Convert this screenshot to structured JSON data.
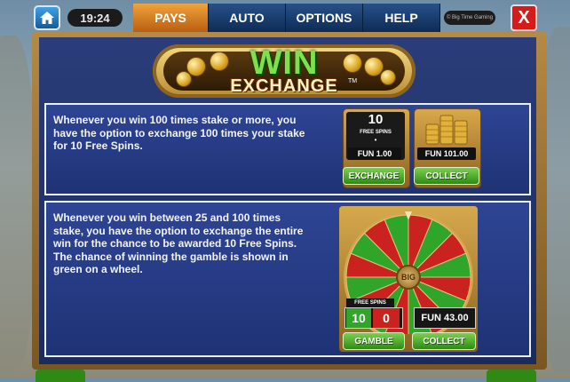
{
  "topbar": {
    "clock": "19:24",
    "tabs": [
      {
        "label": "PAYS",
        "active": true
      },
      {
        "label": "AUTO",
        "active": false
      },
      {
        "label": "OPTIONS",
        "active": false
      },
      {
        "label": "HELP",
        "active": false
      }
    ],
    "brand": "© Big Time Gaming",
    "close_label": "X"
  },
  "title": {
    "line1": "WIN",
    "line2": "EXCHANGE",
    "tm": "TM"
  },
  "panel1": {
    "text": "Whenever you win 100 times stake or more, you have the option to exchange 100 times your stake for 10 Free Spins.",
    "exchange_tile": {
      "count": "10",
      "count_label": "FREE SPINS",
      "dot": "•",
      "fun_value": "FUN 1.00",
      "button": "EXCHANGE"
    },
    "collect_tile": {
      "fun_value": "FUN 101.00",
      "button": "COLLECT"
    }
  },
  "panel2": {
    "text": "Whenever you win between 25 and 100 times stake, you have the option to exchange the entire win for the chance to be awarded 10 Free Spins. The chance of winning the gamble is shown in green on a wheel.",
    "wheel": {
      "center_label": "BIG",
      "colors": {
        "green": "#2fa52a",
        "red": "#c9221f"
      }
    },
    "free_spins_label": "FREE SPINS",
    "spins_win": "10",
    "spins_lose": "0",
    "fun_value": "FUN 43.00",
    "gamble_button": "GAMBLE",
    "collect_button": "COLLECT"
  }
}
